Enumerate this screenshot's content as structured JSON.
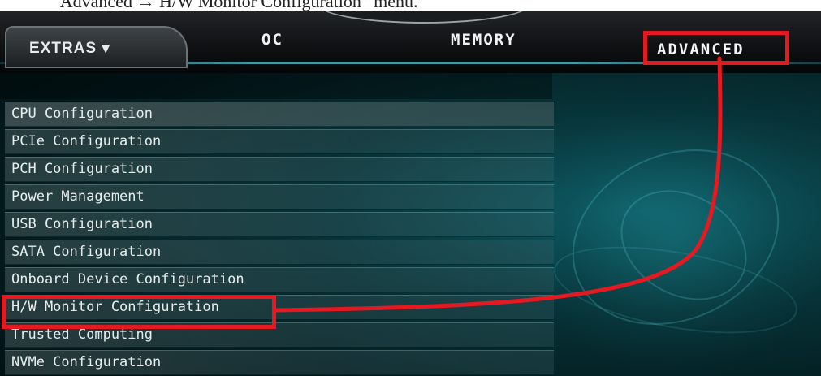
{
  "caption": "“Advanced → H/W Monitor Configuration” menu.",
  "tabs": {
    "extras": "EXTRAS ▾",
    "oc": "OC",
    "memory": "MEMORY",
    "advanced": "ADVANCED"
  },
  "menu_items": [
    "CPU Configuration",
    "PCIe Configuration",
    "PCH Configuration",
    "Power Management",
    "USB Configuration",
    "SATA Configuration",
    "Onboard Device Configuration",
    "H/W Monitor Configuration",
    "Trusted Computing",
    "NVMe Configuration"
  ],
  "highlight_color": "#e31a21",
  "theme": {
    "accent": "#5ad2dc",
    "background": "#031a1d"
  }
}
